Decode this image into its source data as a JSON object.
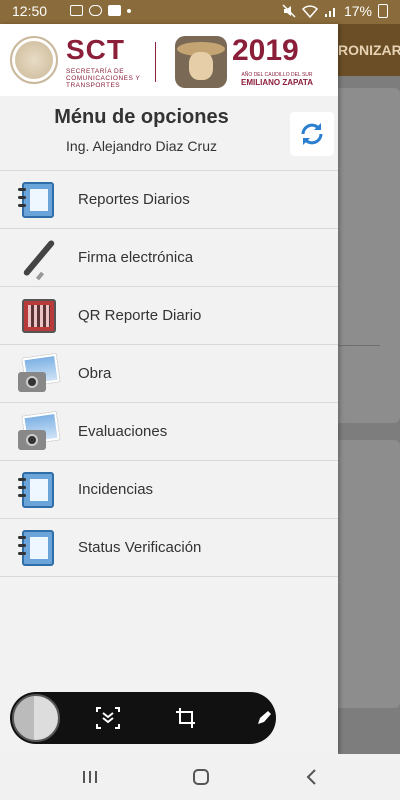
{
  "status_bar": {
    "time": "12:50",
    "battery": "17%",
    "icons": [
      "photo-icon",
      "voicemail-icon",
      "youtube-icon",
      "dot-icon",
      "mute-icon",
      "wifi-icon",
      "signal-icon",
      "battery-icon"
    ]
  },
  "background_app": {
    "header_partial_label": "RONIZAR"
  },
  "drawer": {
    "logos": {
      "sct_title": "SCT",
      "sct_subtitle": "SECRETARÍA DE COMUNICACIONES Y TRANSPORTES",
      "year": "2019",
      "year_subtitle": "AÑO DEL CAUDILLO DEL SUR",
      "year_name": "EMILIANO ZAPATA"
    },
    "title": "Ménu de opciones",
    "user": "Ing. Alejandro Diaz Cruz",
    "sync_icon": "sync-icon",
    "items": [
      {
        "label": "Reportes Diarios",
        "icon": "notebook-icon"
      },
      {
        "label": "Firma electrónica",
        "icon": "pen-icon"
      },
      {
        "label": "QR Reporte Diario",
        "icon": "qr-code-icon"
      },
      {
        "label": "Obra",
        "icon": "camera-photo-icon"
      },
      {
        "label": "Evaluaciones",
        "icon": "camera-photo-icon"
      },
      {
        "label": "Incidencias",
        "icon": "notebook-icon"
      },
      {
        "label": "Status Verificación",
        "icon": "notebook-icon"
      }
    ]
  },
  "screenshot_toolbar": {
    "buttons": [
      "scroll-capture-icon",
      "crop-icon",
      "edit-icon"
    ]
  },
  "nav_bar": {
    "buttons": [
      "recent-apps-icon",
      "home-icon",
      "back-icon"
    ]
  }
}
